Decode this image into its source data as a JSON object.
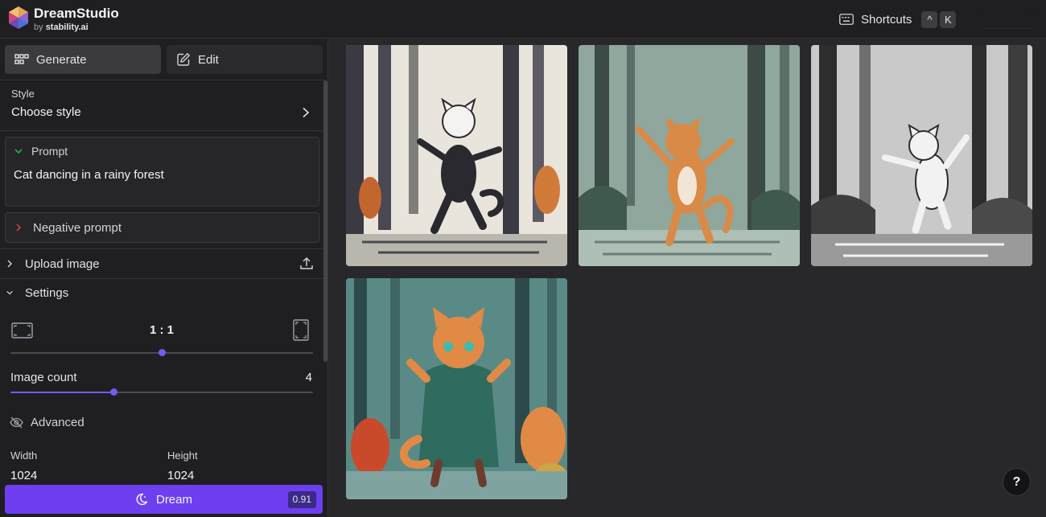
{
  "brand": {
    "name": "DreamStudio",
    "by_prefix": "by",
    "by_company": "stability.ai"
  },
  "header": {
    "shortcuts_label": "Shortcuts",
    "shortcut_keys": [
      "^",
      "K"
    ],
    "keyboard_icon": "keyboard-icon"
  },
  "tabs": [
    {
      "label": "Generate",
      "icon": "grid-icon",
      "active": true
    },
    {
      "label": "Edit",
      "icon": "edit-icon",
      "active": false
    }
  ],
  "style": {
    "label": "Style",
    "value": "Choose style"
  },
  "prompt": {
    "label": "Prompt",
    "text": "Cat dancing in a rainy forest",
    "expanded": true
  },
  "negative_prompt": {
    "label": "Negative prompt",
    "expanded": false
  },
  "upload_image": {
    "label": "Upload image"
  },
  "settings": {
    "label": "Settings",
    "aspect_ratio": "1 : 1",
    "aspect_ratio_fraction": 0.5,
    "image_count_label": "Image count",
    "image_count": "4",
    "image_count_fraction": 0.34,
    "advanced_label": "Advanced",
    "width_label": "Width",
    "width": "1024",
    "height_label": "Height",
    "height": "1024"
  },
  "dream": {
    "label": "Dream",
    "cost": "0.91"
  },
  "gallery": [
    {
      "name": "black-white-cat-forest",
      "palette": [
        "#e9e4dc",
        "#3b3a43",
        "#7d7f7a",
        "#d27a39"
      ]
    },
    {
      "name": "orange-cat-green-forest",
      "palette": [
        "#8fa79c",
        "#3d4b47",
        "#d98a47",
        "#f1e6d6"
      ]
    },
    {
      "name": "white-cat-grey-forest",
      "palette": [
        "#c9c9c9",
        "#2d2d2d",
        "#6f6f6f",
        "#f2f2f2"
      ]
    },
    {
      "name": "orange-cat-teal-coat",
      "palette": [
        "#5a8a86",
        "#2d4a4a",
        "#e08a45",
        "#c94a2a"
      ]
    }
  ],
  "help_label": "?"
}
